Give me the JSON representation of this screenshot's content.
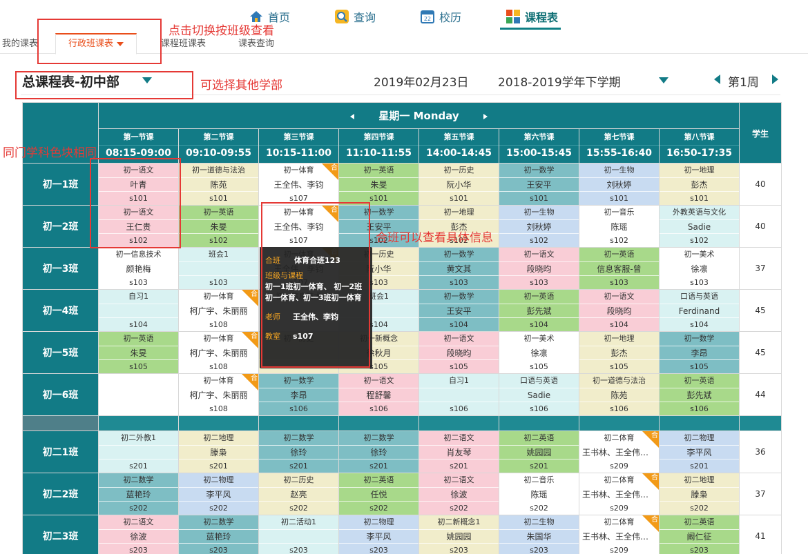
{
  "nav": {
    "items": [
      {
        "label": "首页",
        "icon": "home-icon"
      },
      {
        "label": "查询",
        "icon": "search-icon"
      },
      {
        "label": "校历",
        "icon": "calendar-icon"
      },
      {
        "label": "课程表",
        "icon": "timetable-icon"
      }
    ],
    "active_index": 3
  },
  "tabs": [
    "我的课表",
    "行政班课表",
    "课程班课表",
    "课表查询"
  ],
  "annotations": {
    "switch": "点击切换按班级查看",
    "dept": "可选择其他学部",
    "color": "同门学科色块相同",
    "merge": "合班可以查看具体信息"
  },
  "title": "总课程表-初中部",
  "date": "2019年02月23日",
  "term": "2018-2019学年下学期",
  "week": "第1周",
  "day": "星期一 Monday",
  "periods": [
    {
      "name": "第一节课",
      "time": "08:15-09:00"
    },
    {
      "name": "第二节课",
      "time": "09:10-09:55"
    },
    {
      "name": "第三节课",
      "time": "10:15-11:00"
    },
    {
      "name": "第四节课",
      "time": "11:10-11:55"
    },
    {
      "name": "第五节课",
      "time": "14:00-14:45"
    },
    {
      "name": "第六节课",
      "time": "15:00-15:45"
    },
    {
      "name": "第七节课",
      "time": "15:55-16:40"
    },
    {
      "name": "第八节课",
      "time": "16:50-17:35"
    }
  ],
  "students_header": "学生",
  "merge_badge": "合",
  "colors": {
    "header": "#127b86",
    "语文": "#f9cdd6",
    "英语": "#a8d98a",
    "数学": "#7ebec4",
    "物理": "#c8dbf1",
    "other": "#f1edcb",
    "accent": "#f29a17"
  },
  "group1": [
    {
      "name": "初一1班",
      "students": "40",
      "cells": [
        {
          "s": "初一语文",
          "t": "叶青",
          "r": "s101",
          "c": "pink"
        },
        {
          "s": "初一道德与法治",
          "t": "陈苑",
          "r": "s101",
          "c": "cream"
        },
        {
          "s": "初一体育",
          "t": "王全伟、李钧",
          "r": "s107",
          "c": "white",
          "m": true
        },
        {
          "s": "初一英语",
          "t": "朱旻",
          "r": "s101",
          "c": "green"
        },
        {
          "s": "初一历史",
          "t": "阮小华",
          "r": "s101",
          "c": "cream"
        },
        {
          "s": "初一数学",
          "t": "王安平",
          "r": "s101",
          "c": "teal"
        },
        {
          "s": "初一生物",
          "t": "刘秋婷",
          "r": "s101",
          "c": "blue"
        },
        {
          "s": "初一地理",
          "t": "彭杰",
          "r": "s101",
          "c": "cream"
        }
      ]
    },
    {
      "name": "初一2班",
      "students": "40",
      "cells": [
        {
          "s": "初一语文",
          "t": "王仁贵",
          "r": "s102",
          "c": "pink"
        },
        {
          "s": "初一英语",
          "t": "朱旻",
          "r": "s102",
          "c": "green"
        },
        {
          "s": "初一体育",
          "t": "王全伟、李钧",
          "r": "s107",
          "c": "white",
          "m": true
        },
        {
          "s": "初一数学",
          "t": "王安平",
          "r": "s102",
          "c": "teal"
        },
        {
          "s": "初一地理",
          "t": "彭杰",
          "r": "s102",
          "c": "cream"
        },
        {
          "s": "初一生物",
          "t": "刘秋婷",
          "r": "s102",
          "c": "blue"
        },
        {
          "s": "初一音乐",
          "t": "陈瑶",
          "r": "s102",
          "c": "white"
        },
        {
          "s": "外教英语与文化",
          "t": "Sadie",
          "r": "s102",
          "c": "aqua"
        }
      ]
    },
    {
      "name": "初一3班",
      "students": "37",
      "cells": [
        {
          "s": "初一信息技术",
          "t": "颜艳梅",
          "r": "s103",
          "c": "white"
        },
        {
          "s": "班会1",
          "t": "",
          "r": "s103",
          "c": "aqua"
        },
        {
          "s": "初一体育",
          "t": "王全伟、李钧",
          "r": "s107",
          "c": "white",
          "m": true
        },
        {
          "s": "初一历史",
          "t": "阮小华",
          "r": "s103",
          "c": "cream"
        },
        {
          "s": "初一数学",
          "t": "黄文其",
          "r": "s103",
          "c": "teal"
        },
        {
          "s": "初一语文",
          "t": "段晓昀",
          "r": "s103",
          "c": "pink"
        },
        {
          "s": "初一英语",
          "t": "信息客服-曾",
          "r": "s103",
          "c": "green"
        },
        {
          "s": "初一美术",
          "t": "徐凛",
          "r": "s103",
          "c": "white"
        }
      ]
    },
    {
      "name": "初一4班",
      "students": "45",
      "cells": [
        {
          "s": "自习1",
          "t": "",
          "r": "s104",
          "c": "aqua"
        },
        {
          "s": "初一体育",
          "t": "柯广宇、朱丽丽",
          "r": "s108",
          "c": "white",
          "m": true
        },
        {
          "s": "初一信息技术",
          "t": "",
          "r": "",
          "c": "white"
        },
        {
          "s": "班会1",
          "t": "",
          "r": "s104",
          "c": "aqua"
        },
        {
          "s": "初一数学",
          "t": "王安平",
          "r": "s104",
          "c": "teal"
        },
        {
          "s": "初一英语",
          "t": "彭先斌",
          "r": "s104",
          "c": "green"
        },
        {
          "s": "初一语文",
          "t": "段晓昀",
          "r": "s104",
          "c": "pink"
        },
        {
          "s": "口语与英语",
          "t": "Ferdinand",
          "r": "s104",
          "c": "aqua"
        }
      ]
    },
    {
      "name": "初一5班",
      "students": "45",
      "cells": [
        {
          "s": "初一英语",
          "t": "朱旻",
          "r": "s105",
          "c": "green"
        },
        {
          "s": "初一体育",
          "t": "柯广宇、朱丽丽",
          "r": "s108",
          "c": "white",
          "m": true
        },
        {
          "s": "初一历史",
          "t": "",
          "r": "",
          "c": "cream"
        },
        {
          "s": "初一新概念",
          "t": "徐秋月",
          "r": "s105",
          "c": "cream"
        },
        {
          "s": "初一语文",
          "t": "段晓昀",
          "r": "s105",
          "c": "pink"
        },
        {
          "s": "初一美术",
          "t": "徐凛",
          "r": "s105",
          "c": "white"
        },
        {
          "s": "初一地理",
          "t": "彭杰",
          "r": "s105",
          "c": "cream"
        },
        {
          "s": "初一数学",
          "t": "李昂",
          "r": "s105",
          "c": "teal"
        }
      ]
    },
    {
      "name": "初一6班",
      "students": "44",
      "cells": [
        {
          "s": "",
          "t": "",
          "r": "",
          "c": "white"
        },
        {
          "s": "初一体育",
          "t": "柯广宇、朱丽丽",
          "r": "s108",
          "c": "white",
          "m": true
        },
        {
          "s": "初一数学",
          "t": "李昂",
          "r": "s106",
          "c": "teal"
        },
        {
          "s": "初一语文",
          "t": "程舒馨",
          "r": "s106",
          "c": "pink"
        },
        {
          "s": "自习1",
          "t": "",
          "r": "s106",
          "c": "aqua"
        },
        {
          "s": "口语与英语",
          "t": "Sadie",
          "r": "s106",
          "c": "aqua"
        },
        {
          "s": "初一道德与法治",
          "t": "陈苑",
          "r": "s106",
          "c": "cream"
        },
        {
          "s": "初一英语",
          "t": "彭先斌",
          "r": "s106",
          "c": "green"
        }
      ]
    }
  ],
  "group2": [
    {
      "name": "初二1班",
      "students": "36",
      "cells": [
        {
          "s": "初二外教1",
          "t": "",
          "r": "s201",
          "c": "aqua"
        },
        {
          "s": "初二地理",
          "t": "滕枭",
          "r": "s201",
          "c": "cream"
        },
        {
          "s": "初二数学",
          "t": "徐玲",
          "r": "s201",
          "c": "teal"
        },
        {
          "s": "初二数学",
          "t": "徐玲",
          "r": "s201",
          "c": "teal"
        },
        {
          "s": "初二语文",
          "t": "肖友琴",
          "r": "s201",
          "c": "pink"
        },
        {
          "s": "初二英语",
          "t": "姚园园",
          "r": "s201",
          "c": "green"
        },
        {
          "s": "初二体育",
          "t": "王书林、王全伟、…",
          "r": "s209",
          "c": "white",
          "m": true
        },
        {
          "s": "初二物理",
          "t": "李平风",
          "r": "s201",
          "c": "blue"
        }
      ]
    },
    {
      "name": "初二2班",
      "students": "37",
      "cells": [
        {
          "s": "初二数学",
          "t": "蓝艳玲",
          "r": "s202",
          "c": "teal"
        },
        {
          "s": "初二物理",
          "t": "李平风",
          "r": "s202",
          "c": "blue"
        },
        {
          "s": "初二历史",
          "t": "赵亮",
          "r": "s202",
          "c": "cream"
        },
        {
          "s": "初二英语",
          "t": "任悦",
          "r": "s202",
          "c": "green"
        },
        {
          "s": "初二语文",
          "t": "徐波",
          "r": "s202",
          "c": "pink"
        },
        {
          "s": "初二音乐",
          "t": "陈瑶",
          "r": "s202",
          "c": "white"
        },
        {
          "s": "初二体育",
          "t": "王书林、王全伟、…",
          "r": "s209",
          "c": "white",
          "m": true
        },
        {
          "s": "初二地理",
          "t": "滕枭",
          "r": "s202",
          "c": "cream"
        }
      ]
    },
    {
      "name": "初二3班",
      "students": "41",
      "cells": [
        {
          "s": "初二语文",
          "t": "徐波",
          "r": "s203",
          "c": "pink"
        },
        {
          "s": "初二数学",
          "t": "蓝艳玲",
          "r": "s203",
          "c": "teal"
        },
        {
          "s": "初二活动1",
          "t": "",
          "r": "s203",
          "c": "aqua"
        },
        {
          "s": "初二物理",
          "t": "李平风",
          "r": "s203",
          "c": "blue"
        },
        {
          "s": "初二新概念1",
          "t": "姚园园",
          "r": "s203",
          "c": "cream"
        },
        {
          "s": "初二生物",
          "t": "朱国华",
          "r": "s203",
          "c": "blue"
        },
        {
          "s": "初二体育",
          "t": "王书林、王全伟、…",
          "r": "s209",
          "c": "white",
          "m": true
        },
        {
          "s": "初二英语",
          "t": "阚仁征",
          "r": "s203",
          "c": "green"
        }
      ]
    }
  ],
  "tooltip": {
    "merge_label": "合班",
    "merge_value": "体育合班123",
    "classes_label": "班级与课程",
    "classes_value": "初一1班初一体育、 初一2班初一体育、初一3班初一体育",
    "teacher_label": "老师",
    "teacher_value": "王全伟、李钧",
    "room_label": "教室",
    "room_value": "s107"
  }
}
